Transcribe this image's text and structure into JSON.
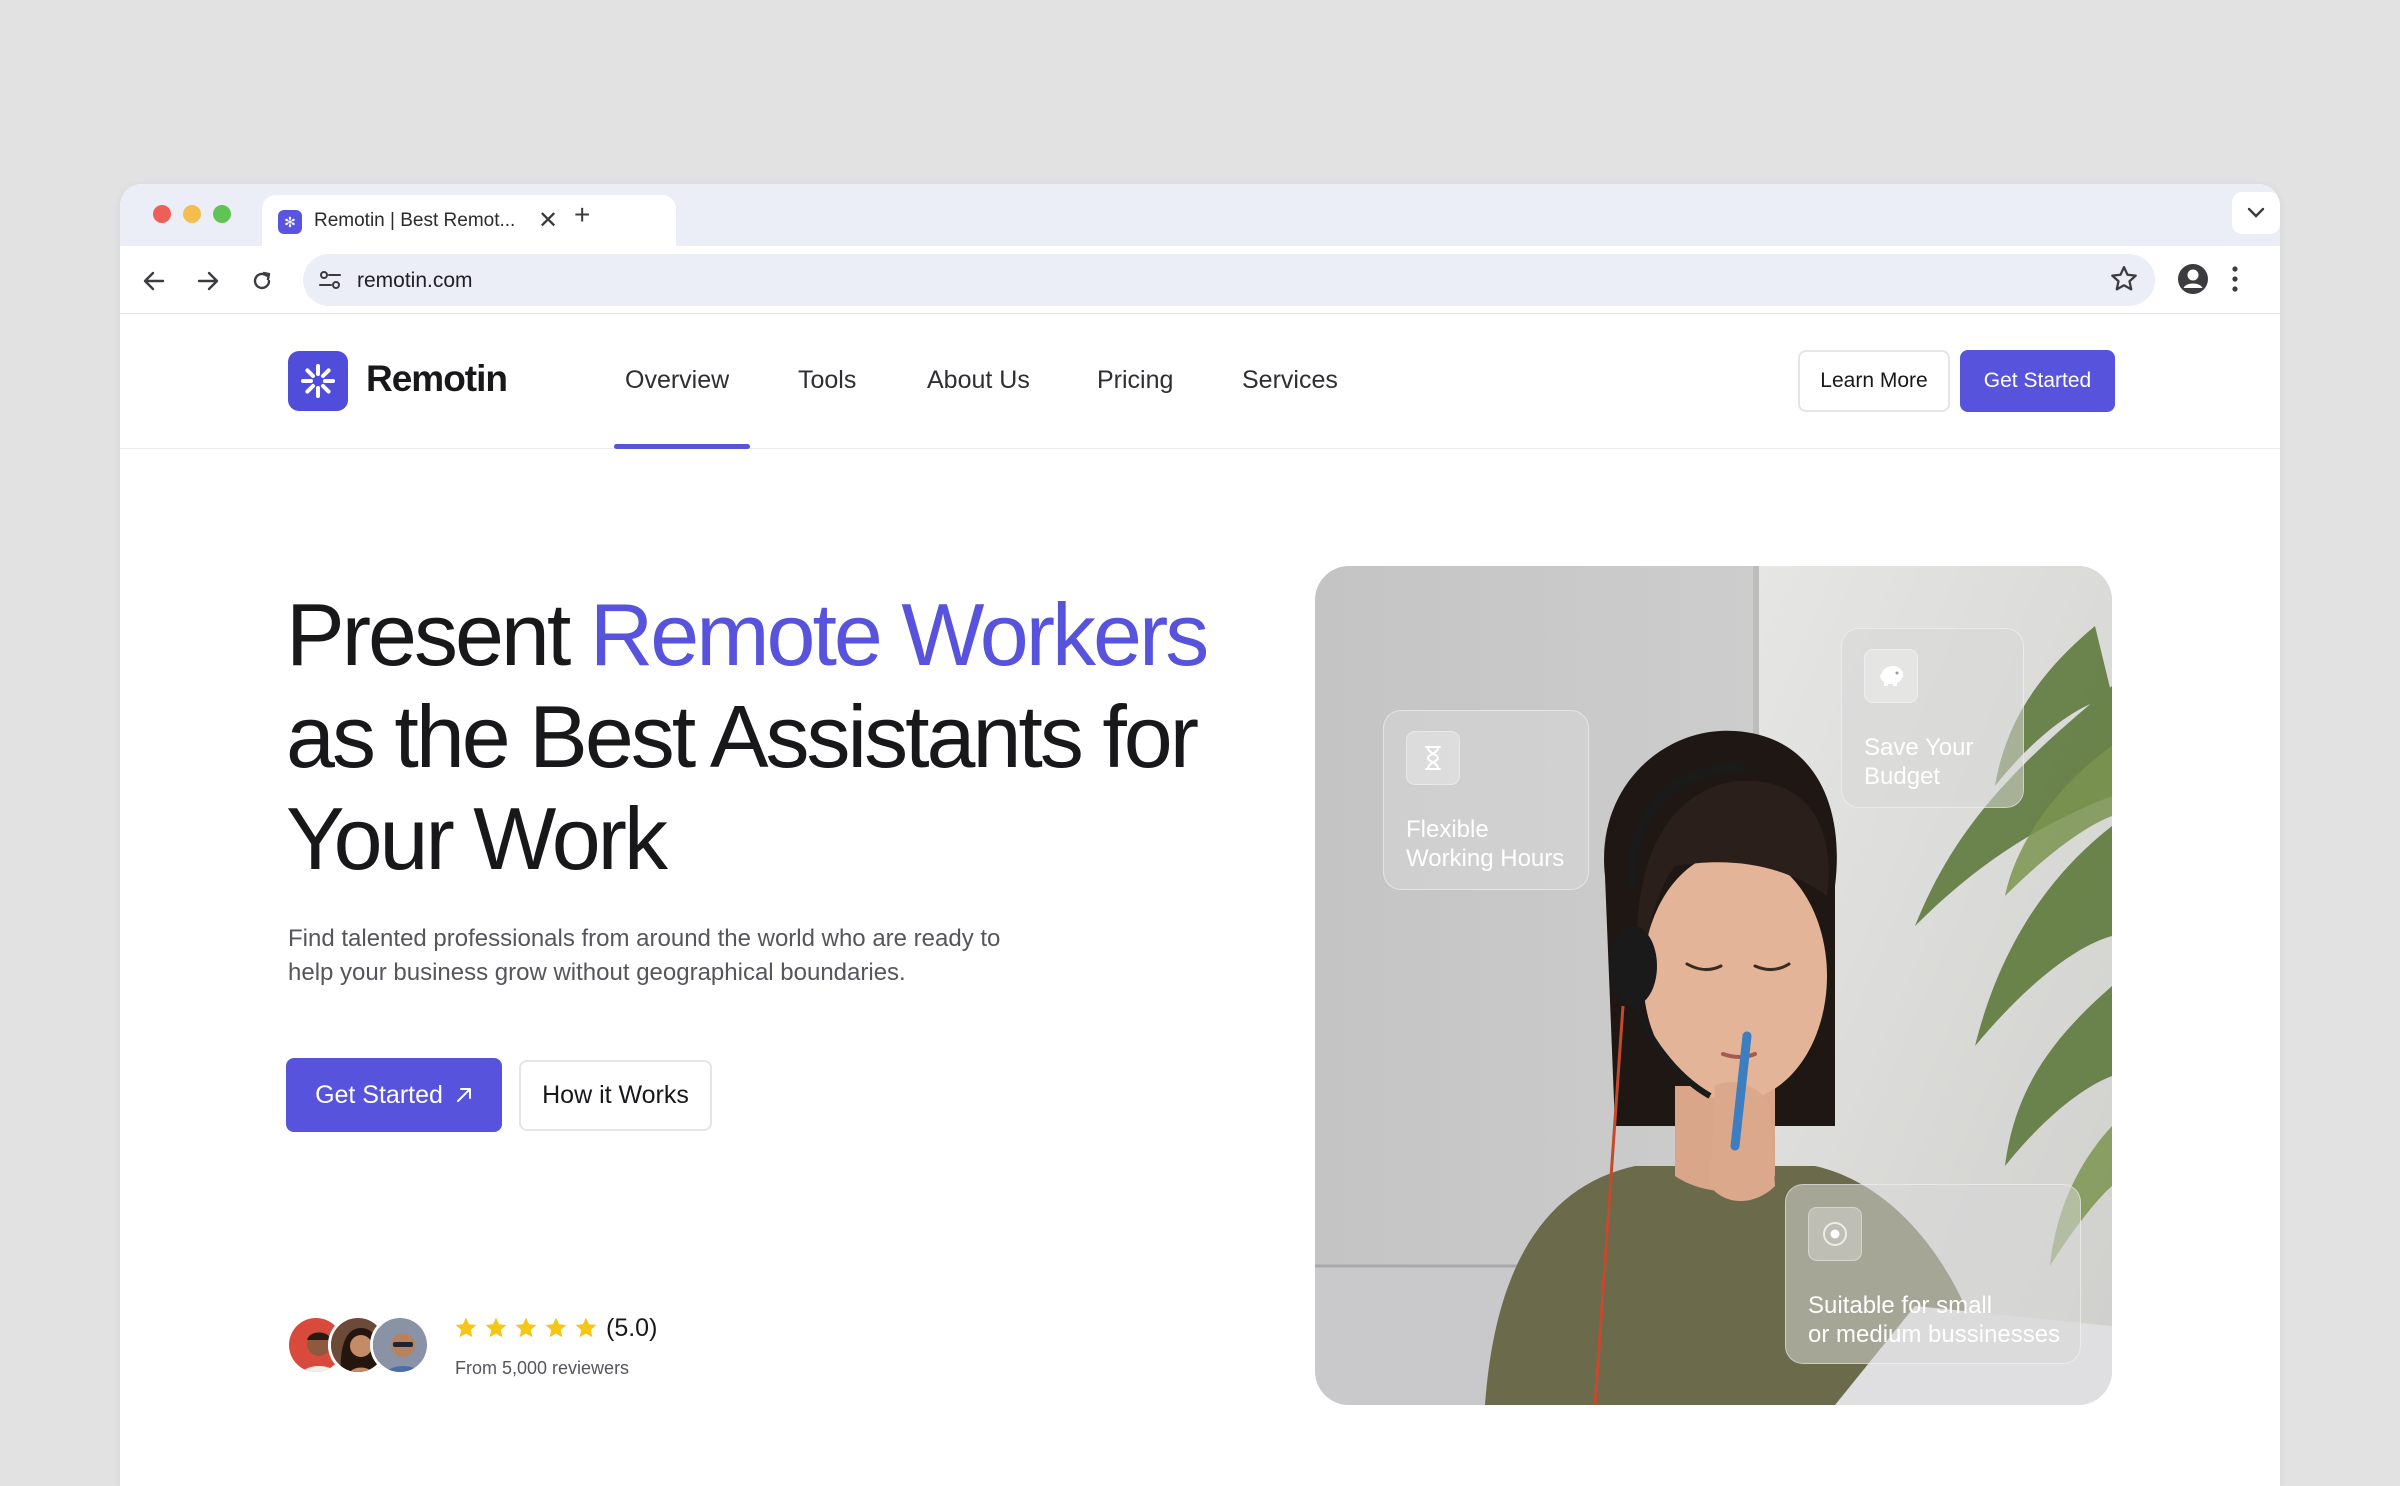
{
  "browser": {
    "tab_title": "Remotin | Best Remot...",
    "url": "remotin.com"
  },
  "site": {
    "brand": "Remotin",
    "nav": [
      "Overview",
      "Tools",
      "About Us",
      "Pricing",
      "Services"
    ],
    "active_nav": "Overview",
    "learn_more": "Learn More",
    "get_started": "Get Started"
  },
  "hero": {
    "title_part1": "Present ",
    "title_accent": "Remote Workers",
    "title_part2": " as the Best Assistants for Your Work",
    "subtitle": "Find talented professionals from around the world who are ready to help your business grow without geographical boundaries.",
    "cta_primary": "Get Started",
    "cta_secondary": "How it Works",
    "rating": 5,
    "rating_max": 5,
    "rating_text": "(5.0)",
    "reviewers": "From 5,000 reviewers"
  },
  "features": {
    "flexible": "Flexible\nWorking Hours",
    "budget": "Save Your\nBudget",
    "suitable": "Suitable for small\nor medium bussinesses"
  },
  "colors": {
    "accent": "#5753dc",
    "star": "#f5c518"
  }
}
